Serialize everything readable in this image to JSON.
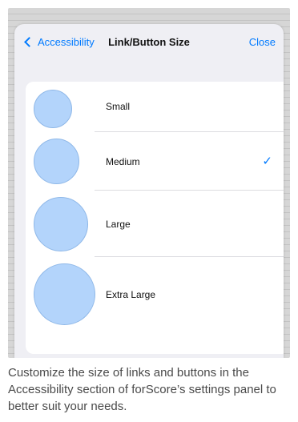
{
  "navbar": {
    "back_label": "Accessibility",
    "title": "Link/Button Size",
    "close_label": "Close"
  },
  "options": [
    {
      "label": "Small",
      "selected": false
    },
    {
      "label": "Medium",
      "selected": true
    },
    {
      "label": "Large",
      "selected": false
    },
    {
      "label": "Extra Large",
      "selected": false
    }
  ],
  "check_glyph": "✓",
  "caption": "Customize the size of links and buttons in the Accessibility section of forScore’s settings panel to better suit your needs.",
  "colors": {
    "accent": "#007aff",
    "circle_fill": "#b3d4fb"
  }
}
